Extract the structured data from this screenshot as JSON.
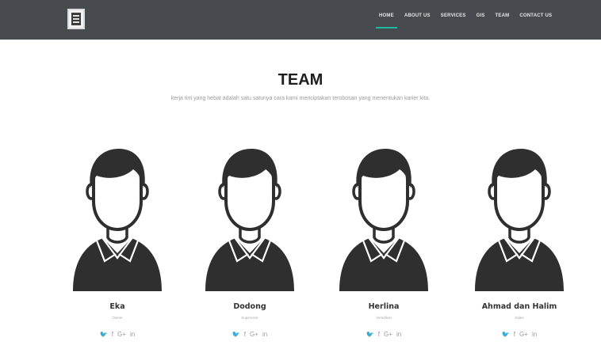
{
  "nav": {
    "items": [
      {
        "label": "HOME",
        "active": true
      },
      {
        "label": "ABOUT US",
        "active": false
      },
      {
        "label": "SERVICES",
        "active": false
      },
      {
        "label": "GIS",
        "active": false
      },
      {
        "label": "TEAM",
        "active": false
      },
      {
        "label": "CONTACT US",
        "active": false
      }
    ]
  },
  "section": {
    "title": "TEAM",
    "subtitle": "kerja tim yang hebat adalah satu satunya cara kami menciptakan terobosan yang menentukan karier kita."
  },
  "team": [
    {
      "name": "Eka",
      "role": "Owner"
    },
    {
      "name": "Dodong",
      "role": "Supervisor"
    },
    {
      "name": "Herlina",
      "role": "Akreditasi"
    },
    {
      "name": "Ahmad dan Halim",
      "role": "Sales"
    }
  ],
  "social": {
    "twitter": "🐦",
    "facebook": "f",
    "google": "G+",
    "linkedin": "in"
  },
  "colors": {
    "navbar": "#474b4f",
    "accent": "#1fb89a",
    "avatar": "#2f2f2f"
  }
}
